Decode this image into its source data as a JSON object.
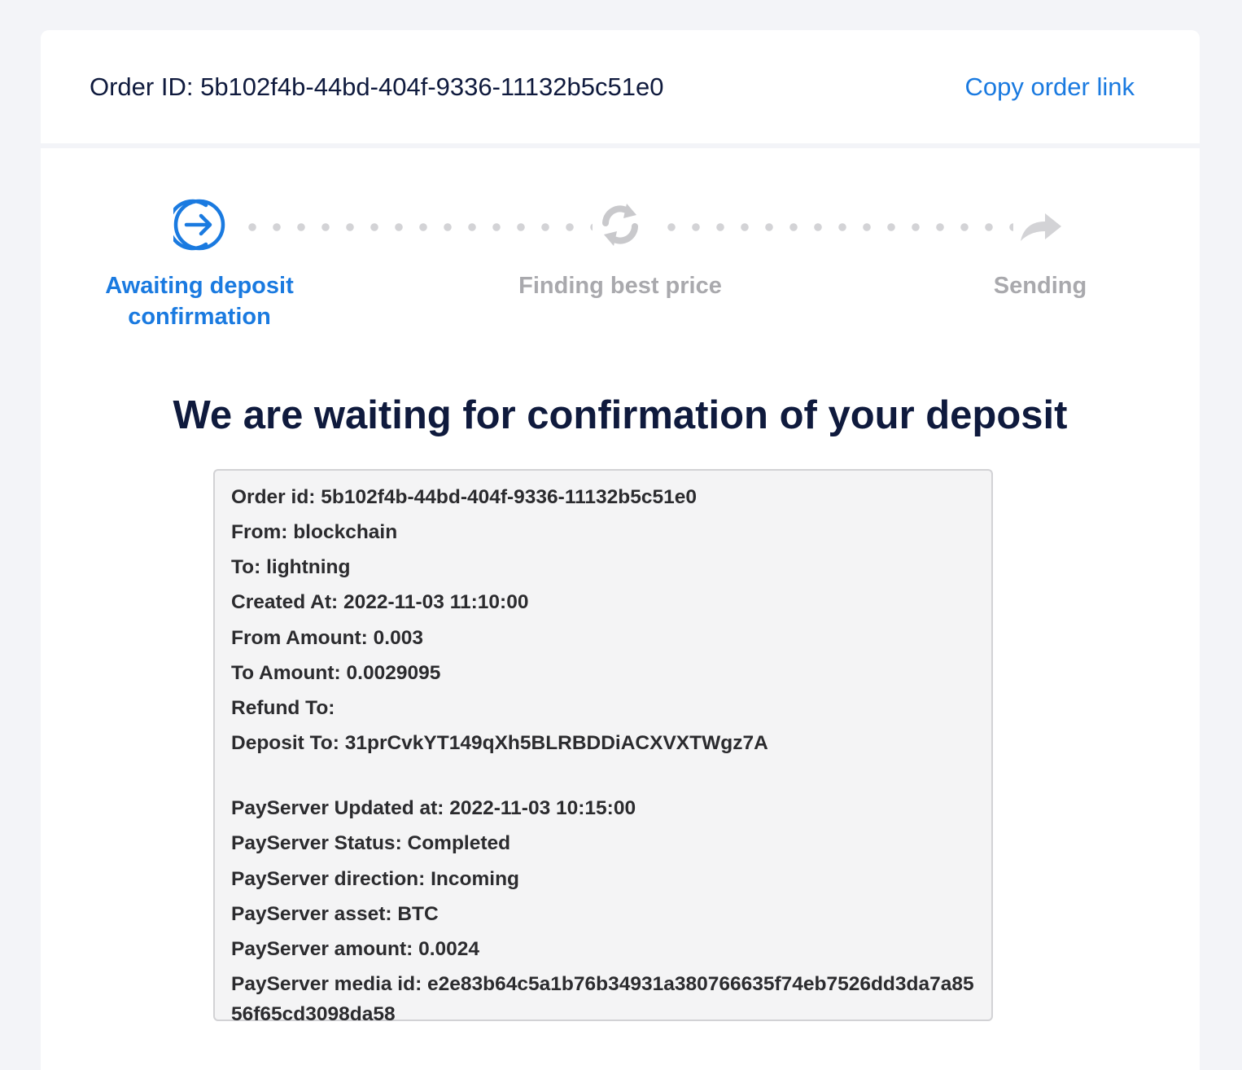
{
  "header": {
    "order_id_text": "Order ID: 5b102f4b-44bd-404f-9336-11132b5c51e0",
    "copy_link_label": "Copy order link"
  },
  "steps": [
    {
      "label": "Awaiting deposit confirmation",
      "icon": "arrow-in-circle-icon",
      "state": "active"
    },
    {
      "label": "Finding best price",
      "icon": "refresh-icon",
      "state": "inactive"
    },
    {
      "label": "Sending",
      "icon": "forward-arrow-icon",
      "state": "inactive"
    }
  ],
  "headline": "We are waiting for confirmation of your deposit",
  "details": {
    "order_id": "Order id: 5b102f4b-44bd-404f-9336-11132b5c51e0",
    "from": "From: blockchain",
    "to": "To: lightning",
    "created_at": "Created At: 2022-11-03 11:10:00",
    "from_amount": "From Amount: 0.003",
    "to_amount": "To Amount: 0.0029095",
    "refund_to": "Refund To:",
    "deposit_to": "Deposit To: 31prCvkYT149qXh5BLRBDDiACXVXTWgz7A",
    "payserver_updated_at": "PayServer Updated at: 2022-11-03 10:15:00",
    "payserver_status": "PayServer Status: Completed",
    "payserver_direction": "PayServer direction: Incoming",
    "payserver_asset": "PayServer asset: BTC",
    "payserver_amount": "PayServer amount: 0.0024",
    "payserver_media_id": "PayServer media id: e2e83b64c5a1b76b34931a380766635f74eb7526dd3da7a8556f65cd3098da58"
  },
  "colors": {
    "accent": "#1a7ae0",
    "inactive": "#a9a9ad",
    "heading": "#0f1a3d",
    "background": "#f3f4f8"
  }
}
